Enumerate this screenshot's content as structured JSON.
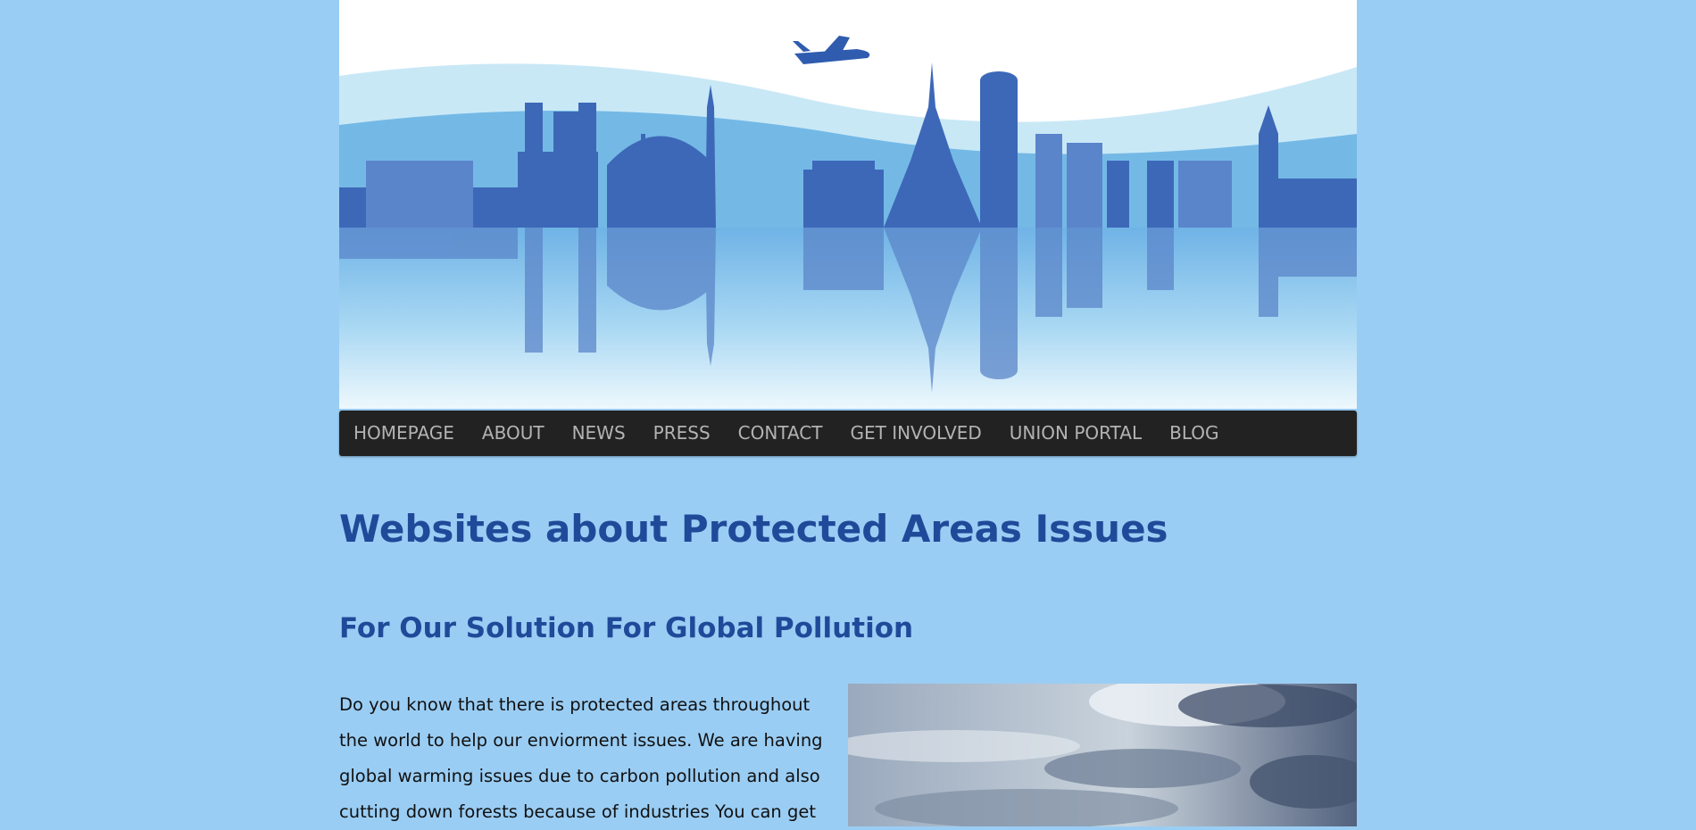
{
  "banner": {
    "alt_icon": "city-skyline-illustration"
  },
  "nav": {
    "items": [
      "HOMEPAGE",
      "ABOUT",
      "NEWS",
      "PRESS",
      "CONTACT",
      "GET INVOLVED",
      "UNION PORTAL",
      "BLOG"
    ]
  },
  "main": {
    "title": "Websites about Protected Areas Issues",
    "subtitle": "For Our Solution For Global Pollution",
    "paragraph": "Do you know that there is protected areas throughout the world to help our enviorment issues. We are having global warming issues due to carbon pollution and also cutting down forests because of industries You can get"
  },
  "colors": {
    "background": "#9acdf4",
    "heading": "#1f4a99",
    "nav_bg": "#222222",
    "nav_text": "#b3b3b3"
  }
}
